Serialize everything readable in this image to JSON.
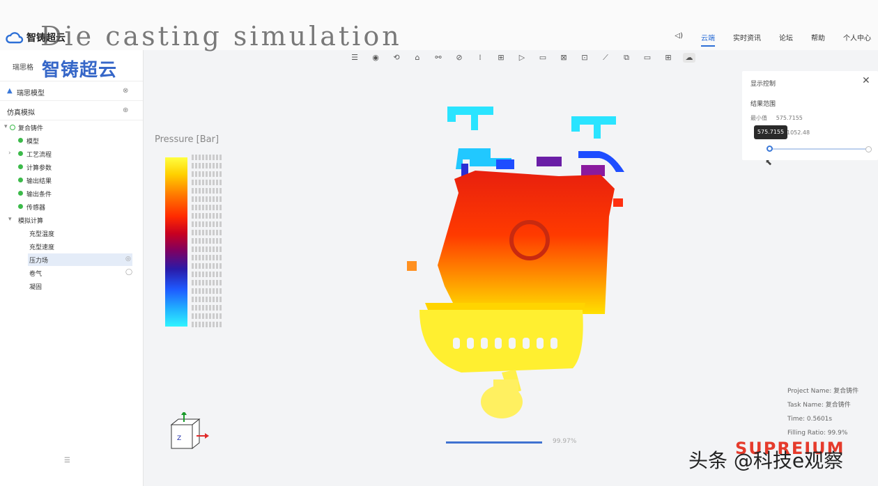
{
  "overlay_title": "Die casting simulation",
  "brand": {
    "logo_text": "智铸超云",
    "small_label": "瑞思格",
    "big_title": "智铸超云"
  },
  "nav": {
    "items": [
      {
        "label": "云端"
      },
      {
        "label": "实时资讯"
      },
      {
        "label": "论坛"
      },
      {
        "label": "帮助"
      },
      {
        "label": "个人中心"
      }
    ],
    "active_index": 0
  },
  "sidebar": {
    "section1": "瑞思模型",
    "section2": "仿真模拟",
    "tree": [
      {
        "label": "复合铸件",
        "indent": 0,
        "dot": false
      },
      {
        "label": "模型",
        "indent": 1,
        "dot": true
      },
      {
        "label": "工艺流程",
        "indent": 1,
        "dot": true
      },
      {
        "label": "计算参数",
        "indent": 1,
        "dot": true
      },
      {
        "label": "输出结果",
        "indent": 1,
        "dot": true
      },
      {
        "label": "输出条件",
        "indent": 1,
        "dot": true
      },
      {
        "label": "传感器",
        "indent": 1,
        "dot": true
      },
      {
        "label": "模拟计算",
        "indent": 0,
        "dot": false
      },
      {
        "label": "充型温度",
        "indent": 2,
        "dot": false
      },
      {
        "label": "充型速度",
        "indent": 2,
        "dot": false
      },
      {
        "label": "压力场",
        "indent": 2,
        "dot": false,
        "selected": true
      },
      {
        "label": "卷气",
        "indent": 2,
        "dot": false
      },
      {
        "label": "凝固",
        "indent": 2,
        "dot": false
      }
    ]
  },
  "legend": {
    "title": "Pressure [Bar]",
    "colors_hex": [
      "#ffff40",
      "#ff2a00",
      "#800060",
      "#1e5aff",
      "#30f4ff"
    ]
  },
  "panel": {
    "title": "显示控制",
    "close_icon": "close-icon",
    "subtitle": "结果范围",
    "row1_label": "最小值",
    "row1_value": "575.7155",
    "row2_value": "1052.48",
    "tooltip": "575.7155"
  },
  "progress": {
    "percent": 99.97,
    "text": "99.97%"
  },
  "info": {
    "project_name": "Project Name: 复合铸件",
    "task_name": "Task Name: 复合铸件",
    "time": "Time: 0.5601s",
    "filling_ratio": "Filling Ratio: 99.9%"
  },
  "brand_bottom": "SUPREIUM",
  "watermark": "头条 @科技e观察"
}
